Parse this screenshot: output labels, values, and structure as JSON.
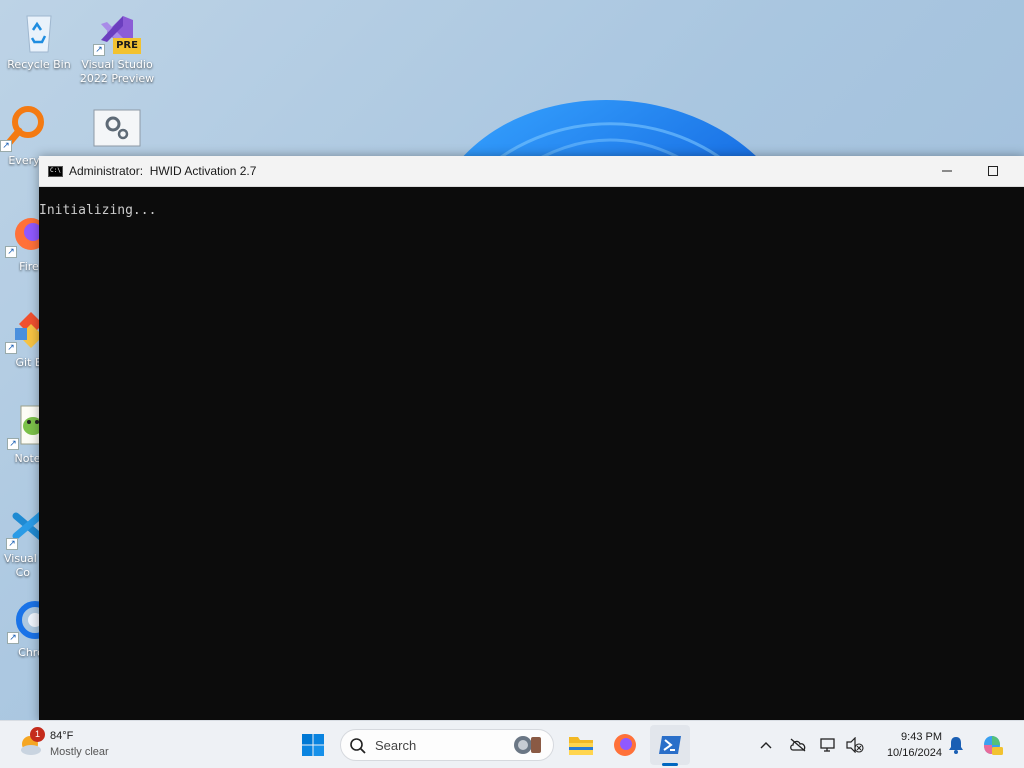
{
  "desktop": {
    "icons": [
      {
        "label": "Recycle Bin",
        "icon": "recycle-bin-icon"
      },
      {
        "label": "Visual Studio 2022 Preview",
        "icon": "visual-studio-icon",
        "badge": "PRE"
      },
      {
        "label": "Every",
        "icon": "everything-search-icon"
      },
      {
        "label": "",
        "icon": "settings-gears-icon"
      },
      {
        "label": "Fire",
        "icon": "firefox-icon"
      },
      {
        "label": "Git B",
        "icon": "git-bash-icon"
      },
      {
        "label": "Notep",
        "icon": "notepad-plus-plus-icon"
      },
      {
        "label_line1": "Visual",
        "label_line2": "Co",
        "icon": "vscode-icon"
      },
      {
        "label": "Chro",
        "icon": "chrome-icon"
      }
    ]
  },
  "console_window": {
    "title": "Administrator:  HWID Activation 2.7",
    "output": "Initializing...",
    "icon": "console-icon",
    "colors": {
      "background": "#0c0c0c",
      "text": "#cccccc"
    }
  },
  "taskbar": {
    "weather": {
      "temperature": "84°F",
      "condition": "Mostly clear",
      "badge": "1"
    },
    "search_label": "Search",
    "apps": [
      "start-icon",
      "file-explorer-icon",
      "firefox-icon",
      "powershell-icon"
    ],
    "clock": {
      "time": "9:43 PM",
      "date": "10/16/2024"
    },
    "tray_icons": [
      "chevron-up-icon",
      "onedrive-icon",
      "network-icon",
      "volume-icon",
      "notification-bell-icon",
      "copilot-icon"
    ]
  }
}
